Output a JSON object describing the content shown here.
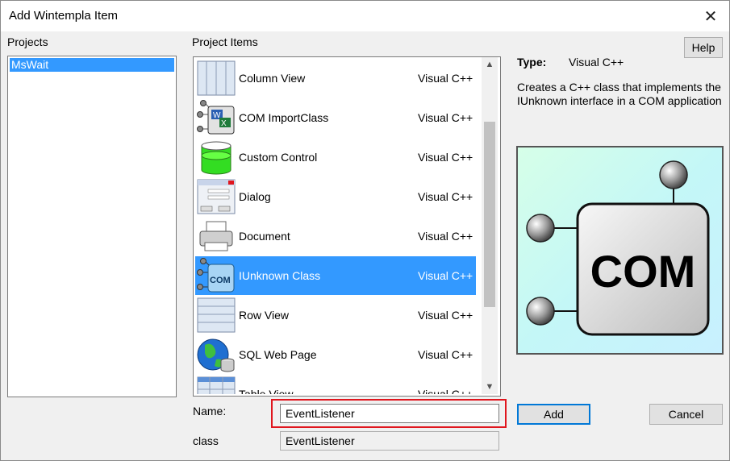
{
  "window": {
    "title": "Add Wintempla Item"
  },
  "projects": {
    "label": "Projects",
    "items": [
      "MsWait"
    ],
    "selected": "MsWait"
  },
  "items": {
    "label": "Project Items",
    "list": [
      {
        "name": "Column View",
        "type": "Visual C++",
        "icon": "column-view-icon"
      },
      {
        "name": "COM ImportClass",
        "type": "Visual C++",
        "icon": "com-import-icon"
      },
      {
        "name": "Custom Control",
        "type": "Visual C++",
        "icon": "custom-control-icon"
      },
      {
        "name": "Dialog",
        "type": "Visual C++",
        "icon": "dialog-icon"
      },
      {
        "name": "Document",
        "type": "Visual C++",
        "icon": "document-icon"
      },
      {
        "name": "IUnknown Class",
        "type": "Visual C++",
        "icon": "com-icon",
        "selected": true
      },
      {
        "name": "Row View",
        "type": "Visual C++",
        "icon": "row-view-icon"
      },
      {
        "name": "SQL Web Page",
        "type": "Visual C++",
        "icon": "sql-web-icon"
      },
      {
        "name": "Table View",
        "type": "Visual C++",
        "icon": "table-view-icon"
      }
    ]
  },
  "details": {
    "type_label": "Type:",
    "type_value": "Visual C++",
    "description": "Creates a C++ class that implements the IUnknown interface in a COM application",
    "preview_text": "COM"
  },
  "form": {
    "name_label": "Name:",
    "name_value": "EventListener",
    "class_label": "class",
    "class_value": "EventListener"
  },
  "buttons": {
    "help": "Help",
    "add": "Add",
    "cancel": "Cancel"
  },
  "colors": {
    "selection": "#3399ff",
    "highlight": "#e0161e",
    "default_button": "#0078d7"
  }
}
